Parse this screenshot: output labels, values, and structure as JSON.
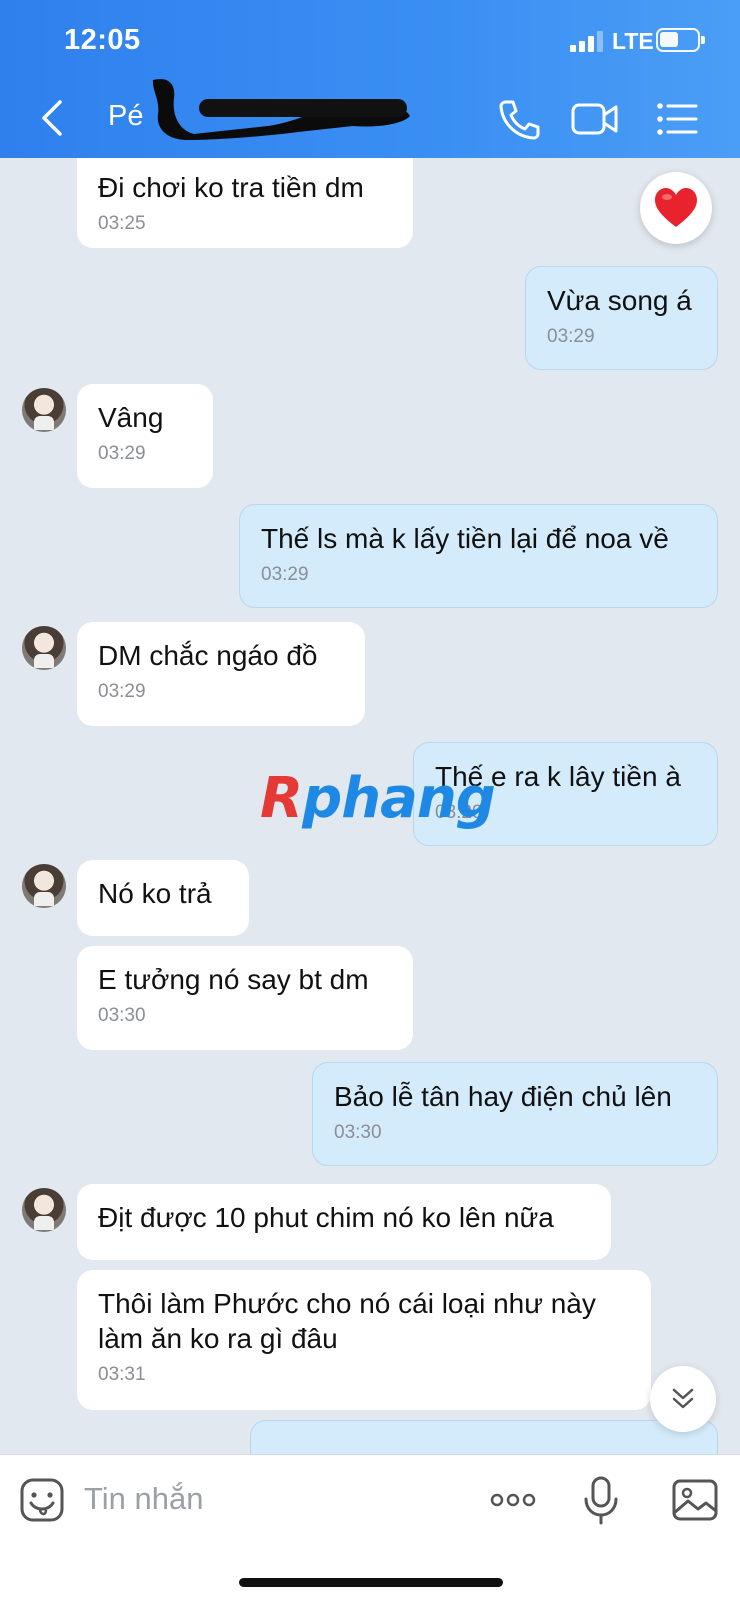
{
  "status_bar": {
    "time": "12:05",
    "network": "LTE"
  },
  "header": {
    "back_icon": "chevron-left-icon",
    "contact_name_visible": "Pé"
  },
  "messages": [
    {
      "dir": "in",
      "text": "Đi chơi ko tra tiền dm",
      "time": "03:25"
    },
    {
      "dir": "out",
      "text": "Vừa song á",
      "time": "03:29"
    },
    {
      "dir": "in",
      "text": "Vâng",
      "time": "03:29"
    },
    {
      "dir": "out",
      "text": "Thế ls mà k lấy tiền lại để noa về",
      "time": "03:29"
    },
    {
      "dir": "in",
      "text": "DM chắc ngáo đồ",
      "time": "03:29"
    },
    {
      "dir": "out",
      "text": "Thế e ra k lây tiền à",
      "time": "03:29"
    },
    {
      "dir": "in",
      "text": "Nó ko trả",
      "time": ""
    },
    {
      "dir": "in",
      "text": "E tưởng nó say bt dm",
      "time": "03:30"
    },
    {
      "dir": "out",
      "text": "Bảo lễ tân hay điện chủ lên",
      "time": "03:30"
    },
    {
      "dir": "in",
      "text": "Địt được 10 phut chim nó ko lên nữa",
      "time": ""
    },
    {
      "dir": "in",
      "text": "Thôi làm Phước cho nó cái loại như này\nlàm ăn ko ra gì đâu",
      "time": "03:31"
    }
  ],
  "watermark": {
    "part1": "R",
    "part2": "phang"
  },
  "input": {
    "placeholder": "Tin nhắn"
  },
  "icons": {
    "heart": "heart-icon",
    "scroll": "chevron-down-double-icon"
  },
  "colors": {
    "header": "#3a8ff3",
    "outgoing_bubble": "#d4ebfb",
    "incoming_bubble": "#ffffff",
    "background": "#e2e8f0"
  }
}
